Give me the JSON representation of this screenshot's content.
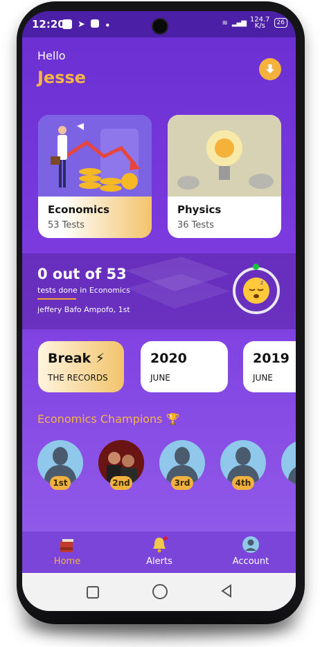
{
  "status_bar": {
    "time": "12:20",
    "network_speed": "124.7\nK/s",
    "battery": "26"
  },
  "greeting": {
    "hello": "Hello",
    "name": "Jesse"
  },
  "download_button": {
    "icon": "download-arrow-icon"
  },
  "subject_cards": [
    {
      "title": "Economics",
      "subtitle": "53 Tests",
      "gradient": [
        "#ffffff",
        "#f2c36b"
      ]
    },
    {
      "title": "Physics",
      "subtitle": "36 Tests"
    }
  ],
  "progress": {
    "title": "0 out of 53",
    "subtitle": "tests done in Economics",
    "leader": "jeffery Bafo Ampofo, 1st"
  },
  "records": [
    {
      "big": "Break ⚡",
      "small": "THE RECORDS",
      "highlight": true
    },
    {
      "big": "2020",
      "small": "JUNE"
    },
    {
      "big": "2019",
      "small": "JUNE"
    }
  ],
  "champions": {
    "title": "Economics Champions 🏆",
    "ranks": [
      "1st",
      "2nd",
      "3rd",
      "4th"
    ]
  },
  "nav": {
    "home": "Home",
    "alerts": "Alerts",
    "account": "Account"
  },
  "colors": {
    "accent": "#f2b23c",
    "primary": "#7b45da"
  }
}
